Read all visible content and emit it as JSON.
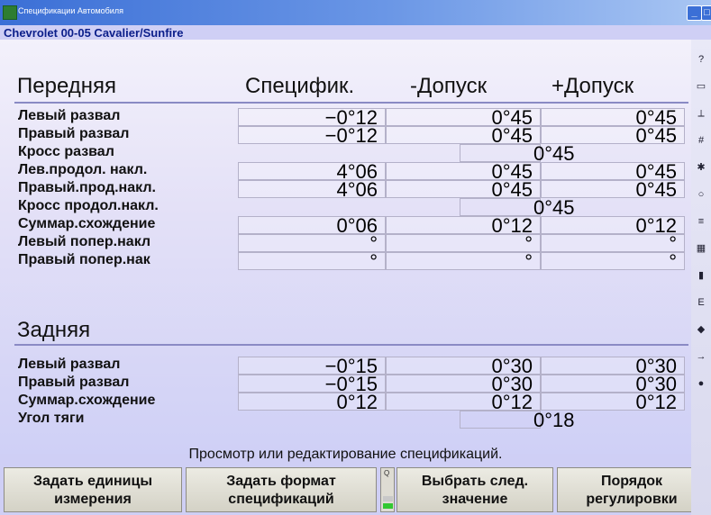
{
  "window": {
    "title": "Спецификации Автомобиля",
    "minimize_glyph": "_",
    "maximize_glyph": "□"
  },
  "vehicle": "Chevrolet 00-05 Cavalier/Sunfire",
  "front": {
    "heading": "Передняя",
    "col_spec": "Специфик.",
    "col_minus": "-Допуск",
    "col_plus": "+Допуск",
    "rows": [
      {
        "label": "Левый развал",
        "spec": "−0°12",
        "minus": "0°45",
        "plus": "0°45"
      },
      {
        "label": "Правый развал",
        "spec": "−0°12",
        "minus": "0°45",
        "plus": "0°45"
      },
      {
        "label": "Кросс развал",
        "cross": "0°45"
      },
      {
        "label": "Лев.продол. накл.",
        "spec": "4°06",
        "minus": "0°45",
        "plus": "0°45"
      },
      {
        "label": "Правый.прод.накл.",
        "spec": "4°06",
        "minus": "0°45",
        "plus": "0°45"
      },
      {
        "label": "Кросс продол.накл.",
        "cross": "0°45"
      },
      {
        "label": "Суммар.схождение",
        "spec": "0°06",
        "minus": "0°12",
        "plus": "0°12"
      },
      {
        "label": "Левый попер.накл",
        "spec": "°",
        "minus": "°",
        "plus": "°"
      },
      {
        "label": "Правый попер.нак",
        "spec": "°",
        "minus": "°",
        "plus": "°"
      }
    ]
  },
  "rear": {
    "heading": "Задняя",
    "rows": [
      {
        "label": "Левый развал",
        "spec": "−0°15",
        "minus": "0°30",
        "plus": "0°30"
      },
      {
        "label": "Правый развал",
        "spec": "−0°15",
        "minus": "0°30",
        "plus": "0°30"
      },
      {
        "label": "Суммар.схождение",
        "spec": "0°12",
        "minus": "0°12",
        "plus": "0°12"
      },
      {
        "label": "Угол тяги",
        "cross": "0°18"
      }
    ]
  },
  "status": "Просмотр или редактирование спецификаций.",
  "buttons": [
    {
      "line1": "Задать единицы",
      "line2": "измерения"
    },
    {
      "line1": "Задать формат",
      "line2": "спецификаций"
    },
    {
      "line1": "Выбрать след.",
      "line2": "значение"
    },
    {
      "line1": "Порядок",
      "line2": "регулировки"
    }
  ],
  "progress_indicator": {
    "label": "Q",
    "level": 0.2
  },
  "colors": {
    "accent": "#0b1e8a",
    "titlebar": "#3b6fd6",
    "progress": "#32c832"
  },
  "sidebar_icons": [
    "help-icon",
    "monitor-icon",
    "measure-icon",
    "spec-value-icon",
    "wrench-icon",
    "wheel-icon",
    "range-icon",
    "calendar-icon",
    "flag-icon",
    "e-icon",
    "car-icon",
    "export-icon",
    "globe-icon"
  ]
}
